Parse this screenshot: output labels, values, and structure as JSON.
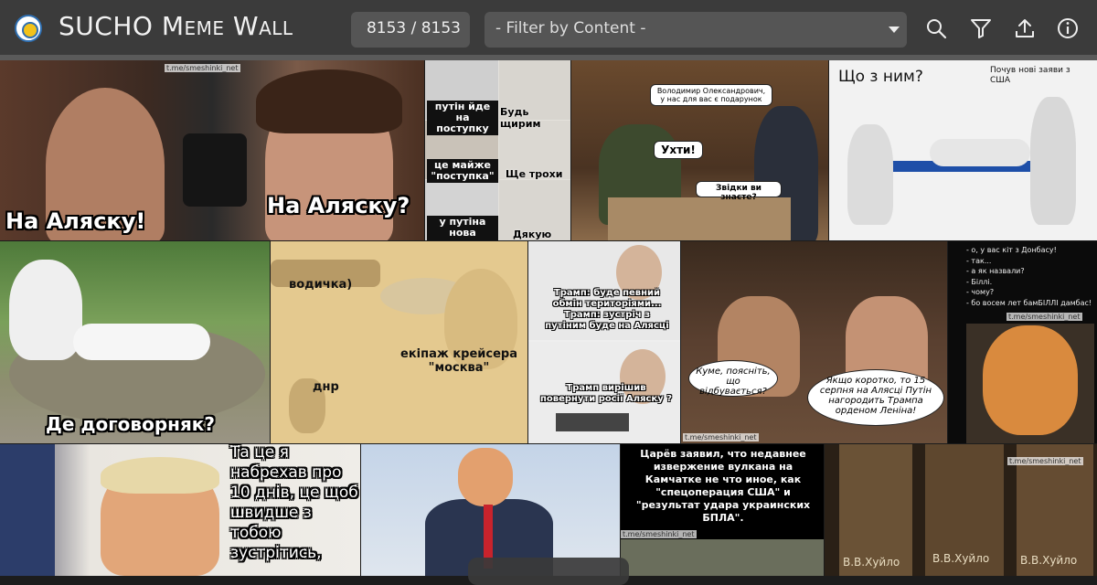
{
  "header": {
    "title": "SUCHO Meme Wall",
    "counter": "8153 / 8153",
    "filter_placeholder": "- Filter by Content -",
    "icons": [
      "search-icon",
      "filter-icon",
      "upload-icon",
      "info-icon"
    ]
  },
  "colors": {
    "topbar": "#3b3b3b",
    "control_bg": "#555555",
    "background": "#1c1c1c"
  },
  "memes": [
    {
      "id": "leon-alaska",
      "captions": [
        "На Аляску!",
        "На Аляску?"
      ],
      "watermark": "t.me/smeshinki_net"
    },
    {
      "id": "putin-concessions",
      "captions": [
        "путін йде на поступку",
        "Будь щирим",
        "це майже \"поступка\"",
        "Ще трохи",
        "у путіна нова вимога",
        "Дякую"
      ]
    },
    {
      "id": "zelensky-gift",
      "captions": [
        "Володимир Олександрович, у нас для вас є подарунок",
        "Ухти!",
        "Звідки ви знаєте?"
      ]
    },
    {
      "id": "what-with-him",
      "captions": [
        "Що з ним?",
        "Почув нові заяви з США"
      ]
    },
    {
      "id": "storks",
      "captions": [
        "Де договорняк?"
      ]
    },
    {
      "id": "cruiser-moskva",
      "captions": [
        "водичка)",
        "екіпаж крейсера \"москва\"",
        "днр"
      ]
    },
    {
      "id": "harold-trump",
      "captions": [
        "Трамп: буде певний обмін територіями... Трамп: зустріч з путіним буде на Алясці",
        "Трамп вирішив повернути росії Аляску ?"
      ]
    },
    {
      "id": "kume-explain",
      "captions": [
        "Куме, поясніть, що відбувається?",
        "Якщо коротко, то 15 серпня на Алясці Путін нагородить Трампа орденом Леніна!"
      ],
      "watermark": "t.me/smeshinki_net"
    },
    {
      "id": "cat-donbass",
      "lines": [
        "- о, у вас кіт з Донбасу!",
        "- так...",
        "- а як назвали?",
        "- Біллі.",
        "- чому?",
        "- бо восем лет бамБІЛЛІ дамбас!"
      ],
      "watermark": "t.me/smeshinki_net"
    },
    {
      "id": "trump-phone",
      "captions": [
        "Та це я набрехав про 10 днів, це щоб швидше з тобою зустрітись,"
      ]
    },
    {
      "id": "trump-open-arms",
      "captions": []
    },
    {
      "id": "kamchatka",
      "captions": [
        "Царёв заявил, что недавнее извержение вулкана на Камчатке не что иное, как \"спецоперация США\" и \"результат удара украинских БПЛА\"."
      ],
      "watermark": "t.me/smeshinki_net"
    },
    {
      "id": "books-khuylo",
      "captions": [
        "В.В.Хуйло",
        "В.В.Хуйло",
        "В.В.Хуйло"
      ],
      "watermark": "t.me/smeshinki_net"
    }
  ]
}
